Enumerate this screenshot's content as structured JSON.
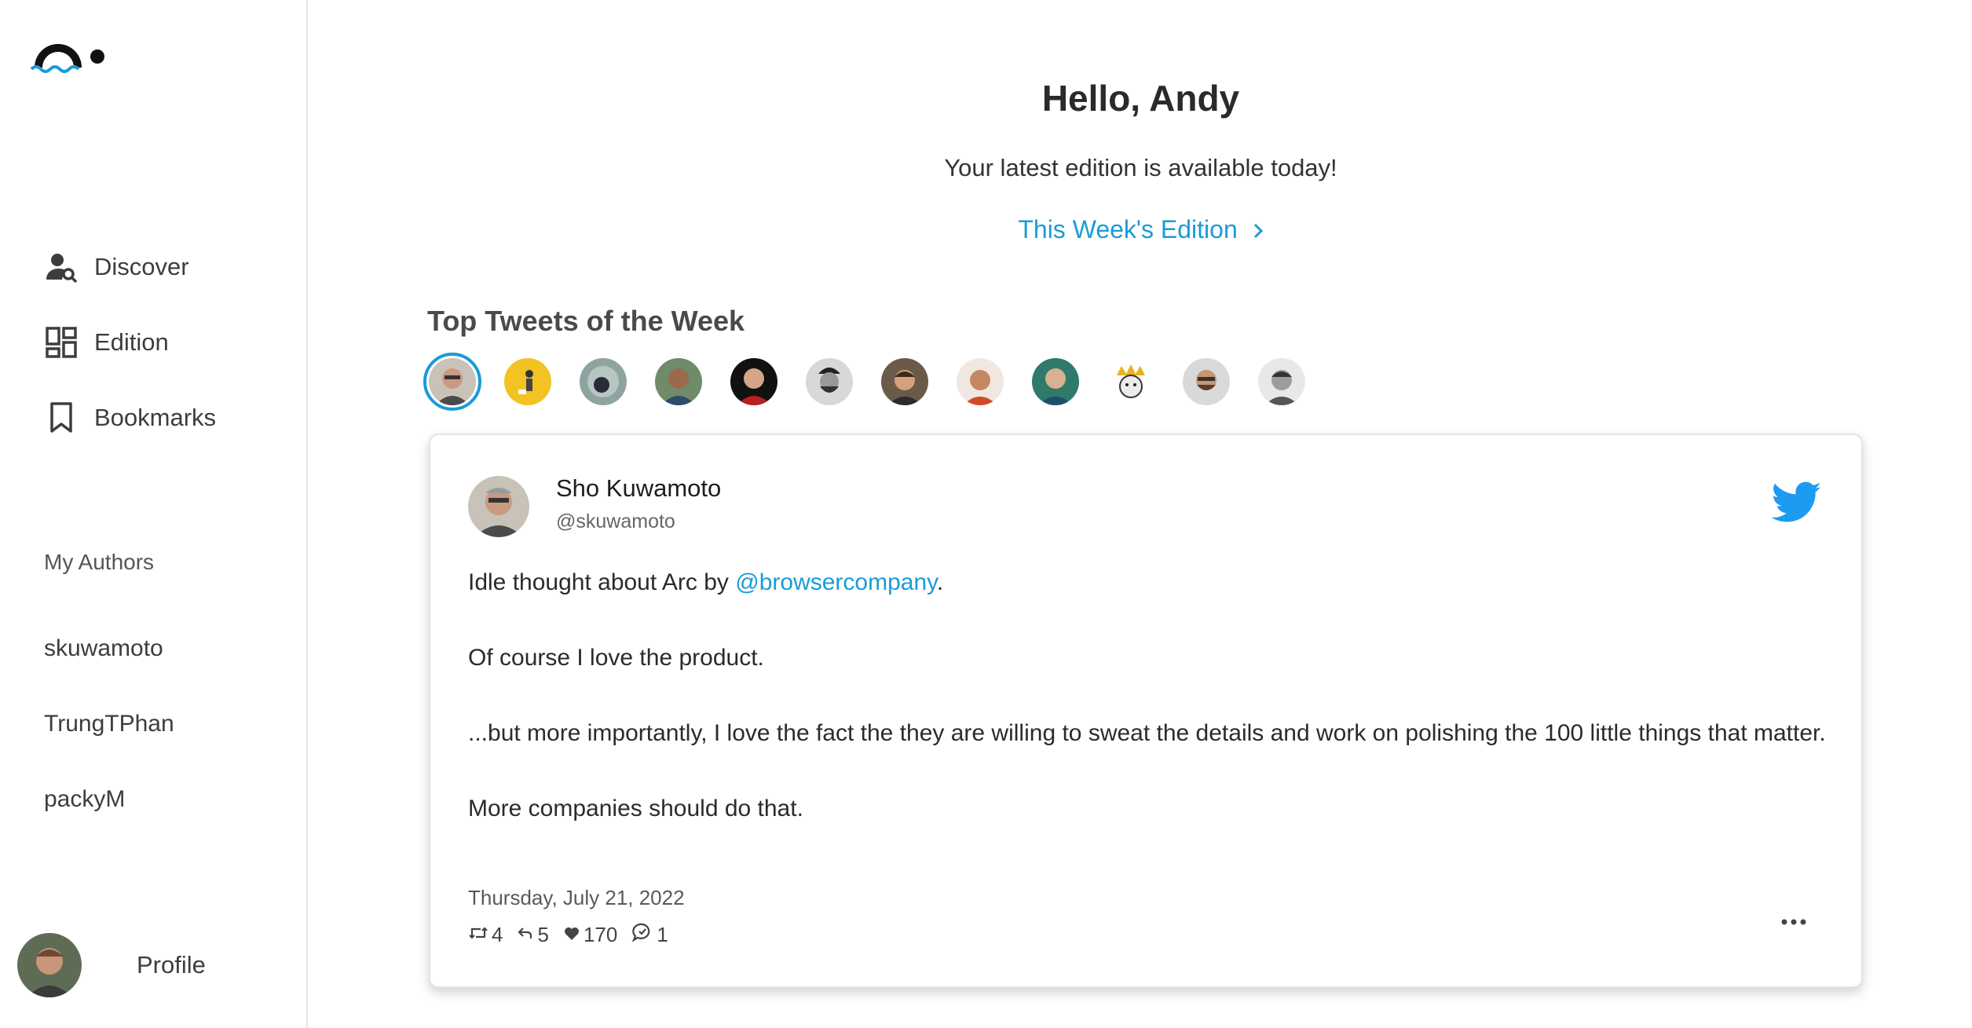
{
  "sidebar": {
    "nav": [
      {
        "label": "Discover",
        "icon": "user-search-icon"
      },
      {
        "label": "Edition",
        "icon": "dashboard-grid-icon"
      },
      {
        "label": "Bookmarks",
        "icon": "bookmark-icon"
      }
    ],
    "authors_label": "My Authors",
    "authors": [
      "skuwamoto",
      "TrungTPhan",
      "packyM"
    ],
    "profile_label": "Profile"
  },
  "main": {
    "greeting": "Hello, Andy",
    "subtitle": "Your latest edition is available today!",
    "edition_link": "This Week's Edition",
    "top_tweets_title": "Top Tweets of the Week"
  },
  "tweet": {
    "author_name": "Sho Kuwamoto",
    "author_handle": "@skuwamoto",
    "line1_prefix": "Idle thought about Arc by ",
    "line1_mention": "@browsercompany",
    "line1_suffix": ".",
    "line2": "Of course I love the product.",
    "line3": "...but more importantly, I love the fact the they are willing to sweat the details and work on polishing the 100 little things that matter.",
    "line4": "More companies should do that.",
    "date": "Thursday, July 21, 2022",
    "retweets": "4",
    "replies": "5",
    "likes": "170",
    "quotes": "1"
  },
  "colors": {
    "accent": "#1a9bd9",
    "twitter": "#1d9bf0"
  }
}
